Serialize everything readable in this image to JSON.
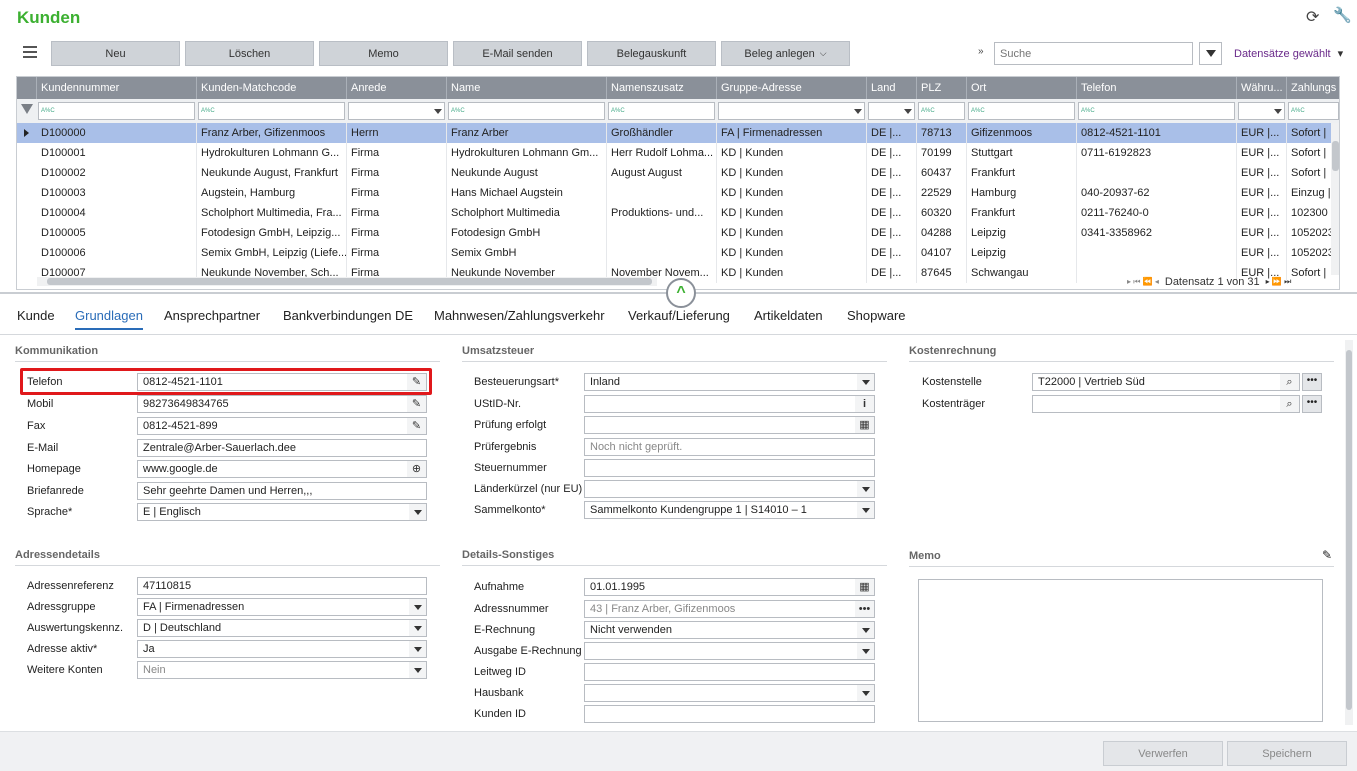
{
  "app": {
    "title": "Kunden"
  },
  "toolbar": {
    "buttons": [
      "Neu",
      "Löschen",
      "Memo",
      "E-Mail senden",
      "Belegauskunft",
      "Beleg anlegen"
    ],
    "search_placeholder": "Suche",
    "selection_label": "Datensätze gewählt"
  },
  "grid": {
    "columns": [
      "Kundennummer",
      "Kunden-Matchcode",
      "Anrede",
      "Name",
      "Namenszusatz",
      "Gruppe-Adresse",
      "Land",
      "PLZ",
      "Ort",
      "Telefon",
      "Währu...",
      "Zahlungs"
    ],
    "filter_hint": "A%C",
    "rows": [
      [
        "D100000",
        "Franz Arber, Gifizenmoos",
        "Herrn",
        "Franz Arber",
        "Großhändler",
        "FA  |  Firmenadressen",
        "DE  |...",
        "78713",
        "Gifizenmoos",
        "0812-4521-1101",
        "EUR  |...",
        "Sofort  |"
      ],
      [
        "D100001",
        "Hydrokulturen Lohmann G...",
        "Firma",
        "Hydrokulturen Lohmann Gm...",
        "Herr Rudolf Lohma...",
        "KD  |  Kunden",
        "DE  |...",
        "70199",
        "Stuttgart",
        "0711-6192823",
        "EUR  |...",
        "Sofort  |"
      ],
      [
        "D100002",
        "Neukunde August, Frankfurt",
        "Firma",
        "Neukunde August",
        "August August",
        "KD  |  Kunden",
        "DE  |...",
        "60437",
        "Frankfurt",
        "",
        "EUR  |...",
        "Sofort  |"
      ],
      [
        "D100003",
        "Augstein, Hamburg",
        "Firma",
        "Hans Michael Augstein",
        "",
        "KD  |  Kunden",
        "DE  |...",
        "22529",
        "Hamburg",
        "040-20937-62",
        "EUR  |...",
        "Einzug  |"
      ],
      [
        "D100004",
        "Scholphort Multimedia, Fra...",
        "Firma",
        "Scholphort Multimedia",
        "Produktions- und...",
        "KD  |  Kunden",
        "DE  |...",
        "60320",
        "Frankfurt",
        "0211-76240-0",
        "EUR  |...",
        "102300  |"
      ],
      [
        "D100005",
        "Fotodesign GmbH, Leipzig...",
        "Firma",
        "Fotodesign GmbH",
        "",
        "KD  |  Kunden",
        "DE  |...",
        "04288",
        "Leipzig",
        "0341-3358962",
        "EUR  |...",
        "10520230"
      ],
      [
        "D100006",
        "Semix GmbH, Leipzig (Liefe...",
        "Firma",
        "Semix GmbH",
        "",
        "KD  |  Kunden",
        "DE  |...",
        "04107",
        "Leipzig",
        "",
        "EUR  |...",
        "10520230"
      ],
      [
        "D100007",
        "Neukunde November, Sch...",
        "Firma",
        "Neukunde November",
        "November Novem...",
        "KD  |  Kunden",
        "DE  |...",
        "87645",
        "Schwangau",
        "",
        "EUR  |...",
        "Sofort  |"
      ]
    ],
    "pager": "Datensatz 1 von 31"
  },
  "tabs": [
    "Kunde",
    "Grundlagen",
    "Ansprechpartner",
    "Bankverbindungen DE",
    "Mahnwesen/Zahlungsverkehr",
    "Verkauf/Lieferung",
    "Artikeldaten",
    "Shopware"
  ],
  "kommunikation": {
    "title": "Kommunikation",
    "fields": [
      {
        "label": "Telefon",
        "value": "0812-4521-1101"
      },
      {
        "label": "Mobil",
        "value": "98273649834765"
      },
      {
        "label": "Fax",
        "value": "0812-4521-899"
      },
      {
        "label": "E-Mail",
        "value": "Zentrale@Arber-Sauerlach.dee"
      },
      {
        "label": "Homepage",
        "value": "www.google.de"
      },
      {
        "label": "Briefanrede",
        "value": "Sehr geehrte Damen und Herren,,,"
      },
      {
        "label": "Sprache*",
        "value": "E  |  Englisch"
      }
    ]
  },
  "umsatzsteuer": {
    "title": "Umsatzsteuer",
    "fields": [
      {
        "label": "Besteuerungsart*",
        "value": "Inland"
      },
      {
        "label": "UStID-Nr.",
        "value": ""
      },
      {
        "label": "Prüfung erfolgt",
        "value": ""
      },
      {
        "label": "Prüfergebnis",
        "value": "Noch nicht geprüft."
      },
      {
        "label": "Steuernummer",
        "value": ""
      },
      {
        "label": "Länderkürzel (nur EU)",
        "value": ""
      },
      {
        "label": "Sammelkonto*",
        "value": "Sammelkonto Kundengruppe 1  |  S14010  –  1"
      }
    ]
  },
  "kostenrechnung": {
    "title": "Kostenrechnung",
    "fields": [
      {
        "label": "Kostenstelle",
        "value": "T22000  |  Vertrieb Süd"
      },
      {
        "label": "Kostenträger",
        "value": ""
      }
    ]
  },
  "adressendetails": {
    "title": "Adressendetails",
    "fields": [
      {
        "label": "Adressenreferenz",
        "value": "47110815"
      },
      {
        "label": "Adressgruppe",
        "value": "FA  |  Firmenadressen"
      },
      {
        "label": "Auswertungskennz.",
        "value": "D  |  Deutschland"
      },
      {
        "label": "Adresse aktiv*",
        "value": "Ja"
      },
      {
        "label": "Weitere Konten",
        "value": "Nein"
      }
    ]
  },
  "details": {
    "title": "Details-Sonstiges",
    "fields": [
      {
        "label": "Aufnahme",
        "value": "01.01.1995"
      },
      {
        "label": "Adressnummer",
        "value": "43  |  Franz Arber, Gifizenmoos"
      },
      {
        "label": "E-Rechnung",
        "value": "Nicht verwenden"
      },
      {
        "label": "Ausgabe E-Rechnung",
        "value": ""
      },
      {
        "label": "Leitweg ID",
        "value": ""
      },
      {
        "label": "Hausbank",
        "value": ""
      },
      {
        "label": "Kunden ID",
        "value": ""
      }
    ]
  },
  "memo": {
    "title": "Memo"
  },
  "footer": {
    "discard": "Verwerfen",
    "save": "Speichern"
  },
  "colors": {
    "accent": "#3cb031",
    "highlight": "#e0181b",
    "selected_row": "#a9bfe8"
  }
}
